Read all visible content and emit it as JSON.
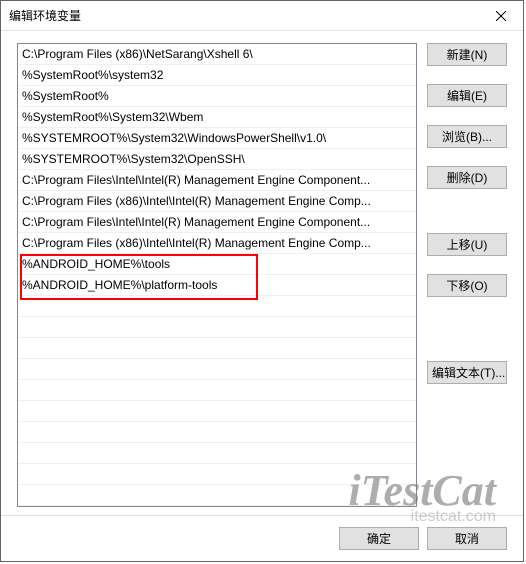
{
  "dialog": {
    "title": "编辑环境变量"
  },
  "list": {
    "items": [
      "C:\\Program Files (x86)\\NetSarang\\Xshell 6\\",
      "%SystemRoot%\\system32",
      "%SystemRoot%",
      "%SystemRoot%\\System32\\Wbem",
      "%SYSTEMROOT%\\System32\\WindowsPowerShell\\v1.0\\",
      "%SYSTEMROOT%\\System32\\OpenSSH\\",
      "C:\\Program Files\\Intel\\Intel(R) Management Engine Component...",
      "C:\\Program Files (x86)\\Intel\\Intel(R) Management Engine Comp...",
      "C:\\Program Files\\Intel\\Intel(R) Management Engine Component...",
      "C:\\Program Files (x86)\\Intel\\Intel(R) Management Engine Comp...",
      "%ANDROID_HOME%\\tools",
      "%ANDROID_HOME%\\platform-tools"
    ]
  },
  "buttons": {
    "new": "新建(N)",
    "edit": "编辑(E)",
    "browse": "浏览(B)...",
    "delete": "删除(D)",
    "moveUp": "上移(U)",
    "moveDown": "下移(O)",
    "editText": "编辑文本(T)...",
    "ok": "确定",
    "cancel": "取消"
  },
  "watermark": {
    "big": "iTestCat",
    "small": "itestcat.com"
  }
}
